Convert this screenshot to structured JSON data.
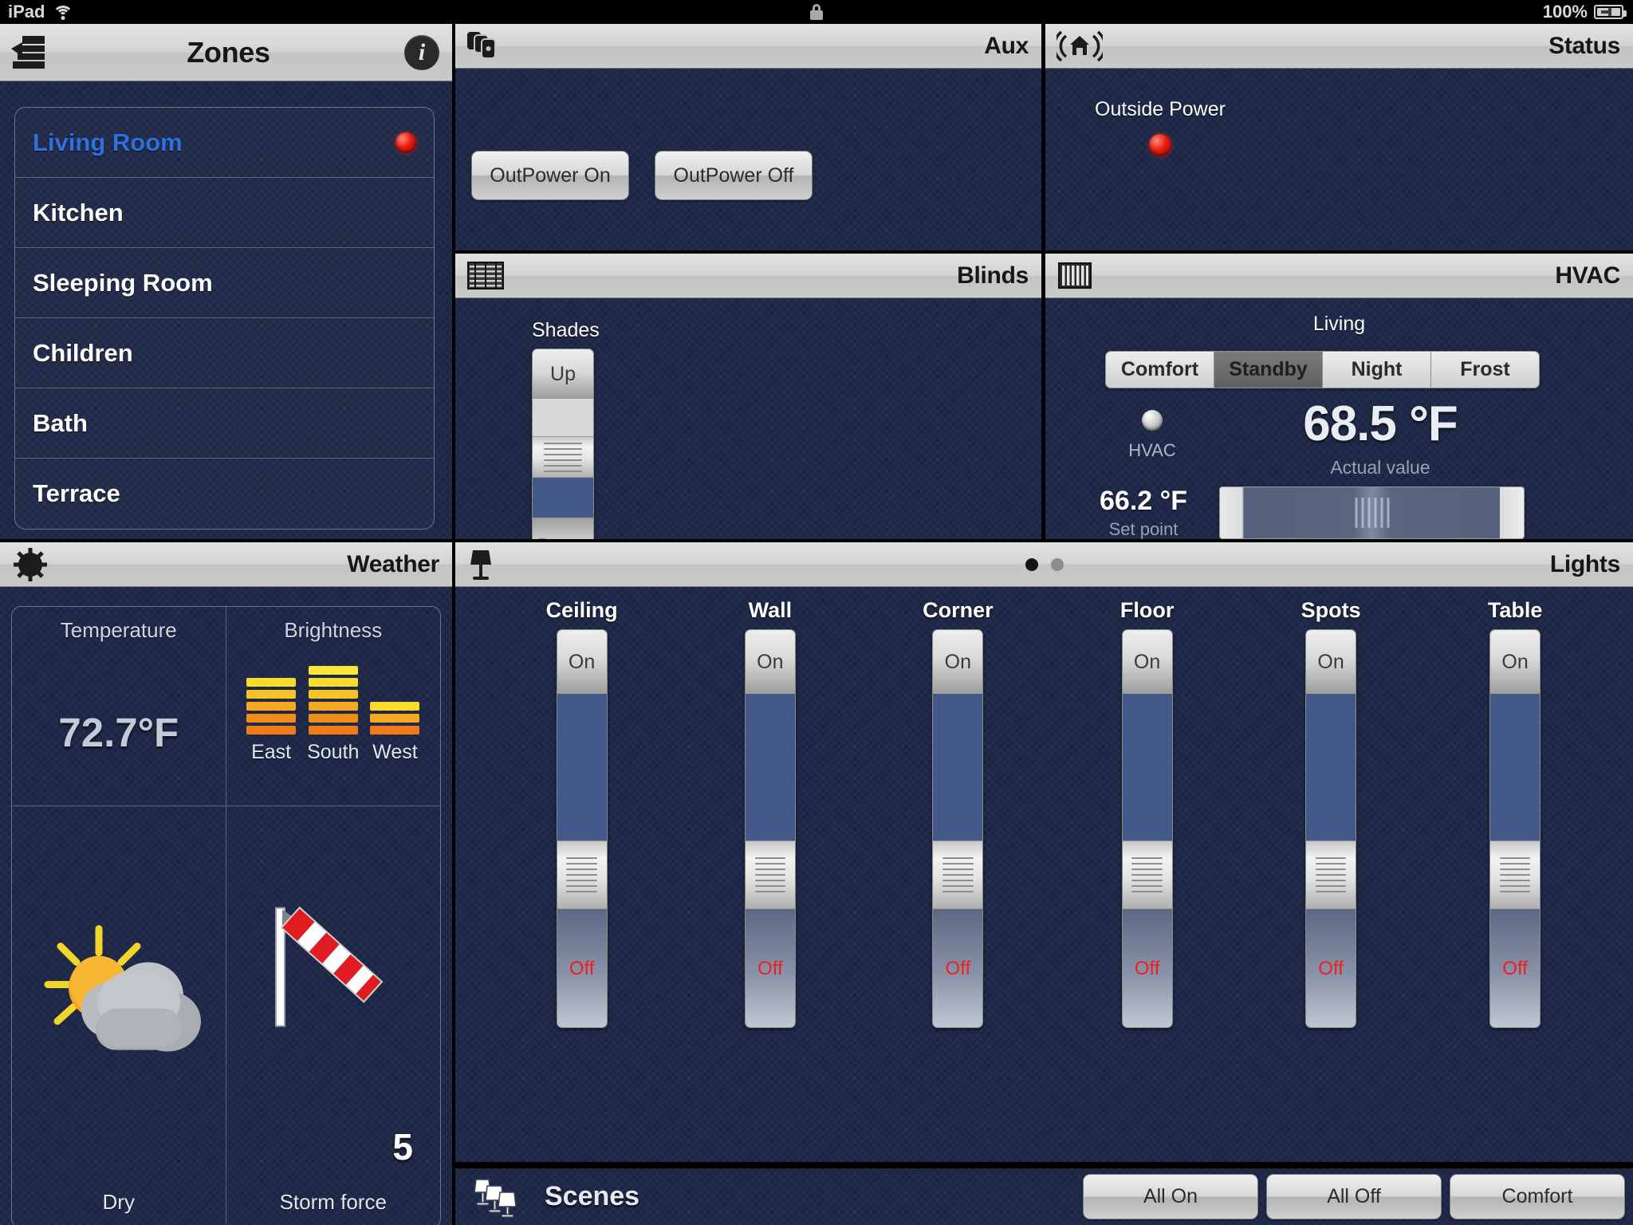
{
  "statusbar": {
    "device": "iPad",
    "wifi_icon": "wifi-icon",
    "lock_icon": "lock-icon",
    "battery_text": "100%",
    "battery_icon": "battery-charging-icon"
  },
  "zones": {
    "title": "Zones",
    "icon": "zones-list-icon",
    "info_label": "i",
    "items": [
      {
        "label": "Living Room",
        "active": true,
        "led": "red"
      },
      {
        "label": "Kitchen",
        "active": false,
        "led": "none"
      },
      {
        "label": "Sleeping Room",
        "active": false,
        "led": "none"
      },
      {
        "label": "Children",
        "active": false,
        "led": "none"
      },
      {
        "label": "Bath",
        "active": false,
        "led": "none"
      },
      {
        "label": "Terrace",
        "active": false,
        "led": "none"
      }
    ]
  },
  "aux": {
    "title": "Aux",
    "icon": "stacked-cards-icon",
    "buttons": [
      {
        "label": "OutPower On"
      },
      {
        "label": "OutPower Off"
      }
    ]
  },
  "status": {
    "title": "Status",
    "icon": "house-signal-icon",
    "items": [
      {
        "label": "Outside Power",
        "led": "red"
      }
    ]
  },
  "blinds": {
    "title": "Blinds",
    "icon": "blinds-icon",
    "slider": {
      "label": "Shades",
      "top_label": "Up",
      "bottom_label": "Down"
    }
  },
  "hvac": {
    "title": "HVAC",
    "icon": "radiator-icon",
    "zone_name": "Living",
    "modes": [
      {
        "label": "Comfort",
        "selected": false
      },
      {
        "label": "Standby",
        "selected": true
      },
      {
        "label": "Night",
        "selected": false
      },
      {
        "label": "Frost",
        "selected": false
      }
    ],
    "led_label": "HVAC",
    "led": "grey",
    "actual_value": "68.5 °F",
    "actual_label": "Actual value",
    "setpoint_value": "66.2 °F",
    "setpoint_label": "Set point"
  },
  "weather": {
    "title": "Weather",
    "icon": "sun-icon",
    "temperature_label": "Temperature",
    "temperature_value": "72.7°F",
    "brightness_label": "Brightness",
    "brightness": [
      {
        "name": "East",
        "bars": 5
      },
      {
        "name": "South",
        "bars": 6
      },
      {
        "name": "West",
        "bars": 3
      }
    ],
    "condition_label": "Dry",
    "condition_icon": "sun-behind-cloud-icon",
    "wind_label": "Storm force",
    "wind_value": "5",
    "wind_icon": "windsock-icon"
  },
  "lights": {
    "title": "Lights",
    "icon": "table-lamp-icon",
    "page_dots": {
      "count": 2,
      "active_index": 0
    },
    "sliders": [
      {
        "name": "Ceiling",
        "on_label": "On",
        "off_label": "Off"
      },
      {
        "name": "Wall",
        "on_label": "On",
        "off_label": "Off"
      },
      {
        "name": "Corner",
        "on_label": "On",
        "off_label": "Off"
      },
      {
        "name": "Floor",
        "on_label": "On",
        "off_label": "Off"
      },
      {
        "name": "Spots",
        "on_label": "On",
        "off_label": "Off"
      },
      {
        "name": "Table",
        "on_label": "On",
        "off_label": "Off"
      }
    ]
  },
  "scenes": {
    "title": "Scenes",
    "icon": "lamps-group-icon",
    "buttons": [
      {
        "label": "All On"
      },
      {
        "label": "All Off"
      },
      {
        "label": "Comfort"
      }
    ]
  },
  "colors": {
    "panel_bg": "#1b2544",
    "header_bg": "#d4d4d4",
    "accent_blue": "#2f6fe0",
    "led_red": "#e81b10",
    "slider_fill": "#42598a",
    "off_red": "#ef1f1f"
  }
}
